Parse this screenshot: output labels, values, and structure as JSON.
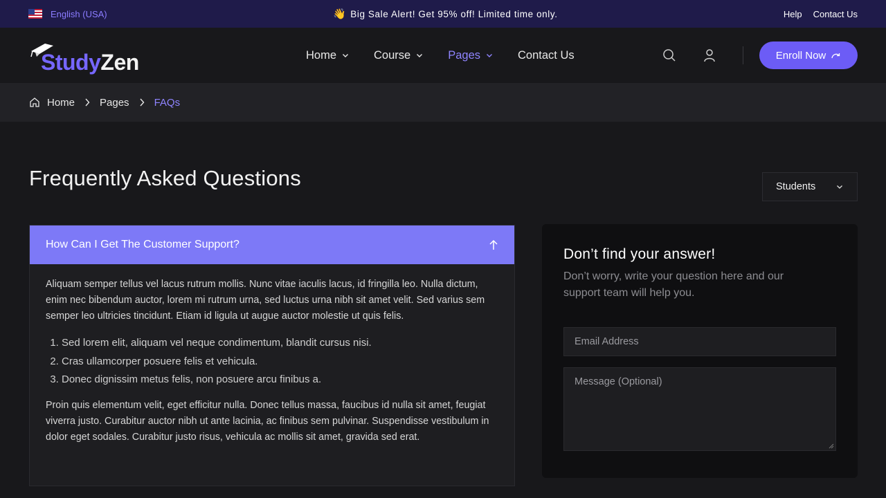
{
  "topbar": {
    "language": "English (USA)",
    "promo_emoji": "👋",
    "promo": "Big Sale Alert! Get 95% off! Limited time only.",
    "help": "Help",
    "contact": "Contact Us"
  },
  "header": {
    "brand_part1": "Study",
    "brand_part2": "Zen",
    "nav": [
      {
        "label": "Home",
        "has_dropdown": true
      },
      {
        "label": "Course",
        "has_dropdown": true
      },
      {
        "label": "Pages",
        "has_dropdown": true,
        "active": true
      },
      {
        "label": "Contact Us",
        "has_dropdown": false
      }
    ],
    "enroll_label": "Enroll Now",
    "icons": [
      "search-icon",
      "user-icon",
      "arrow-icon"
    ]
  },
  "breadcrumb": {
    "items": [
      "Home",
      "Pages",
      "FAQs"
    ]
  },
  "main": {
    "title": "Frequently Asked Questions",
    "filter_value": "Students",
    "faq": {
      "question": "How Can I Get The Customer Support?",
      "paragraph1": "Aliquam semper tellus vel lacus rutrum mollis. Nunc vitae iaculis lacus, id fringilla leo. Nulla dictum, enim nec bibendum auctor, lorem mi rutrum urna, sed luctus urna nibh sit amet velit. Sed varius sem semper leo ultricies tincidunt. Etiam id ligula ut augue auctor molestie ut quis felis.",
      "list": [
        "Sed lorem elit, aliquam vel neque condimentum, blandit cursus nisi.",
        "Cras ullamcorper posuere felis et vehicula.",
        "Donec dignissim metus felis, non posuere arcu finibus a."
      ],
      "paragraph2": "Proin quis elementum velit, eget efficitur nulla. Donec tellus massa, faucibus id nulla sit amet, feugiat viverra justo. Curabitur auctor nibh ut ante lacinia, ac finibus sem pulvinar. Suspendisse vestibulum in dolor eget sodales. Curabitur justo risus, vehicula ac mollis sit amet, gravida sed erat."
    },
    "side": {
      "title": "Don’t find your answer!",
      "subtitle": "Don’t worry, write your question here and our support team will help you.",
      "email_placeholder": "Email Address",
      "message_placeholder": "Message (Optional)"
    }
  },
  "colors": {
    "accent": "#6c5cf6",
    "accent_light": "#8f84ff",
    "topbar_bg": "#1f1b4a",
    "accordion_head": "#7d79f7"
  }
}
